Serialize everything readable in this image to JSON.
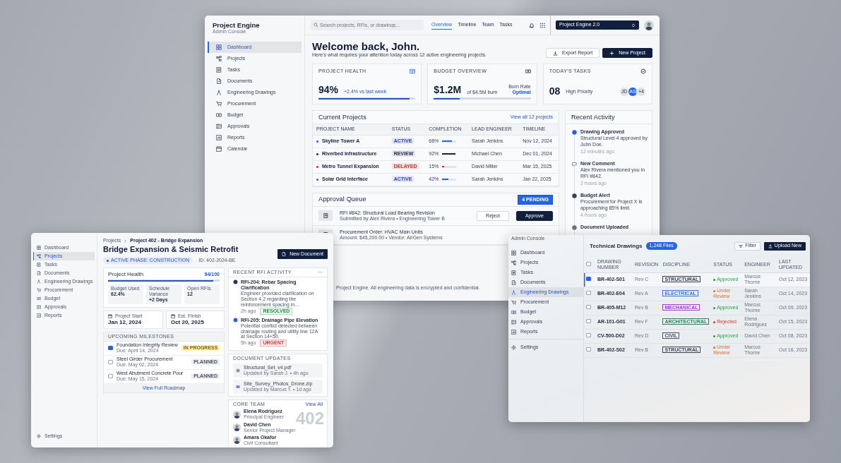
{
  "main_window": {
    "brand": {
      "title": "Project Engine",
      "subtitle": "Admin Console"
    },
    "sidebar": [
      {
        "label": "Dashboard",
        "selected": true
      },
      {
        "label": "Projects",
        "selected": false
      },
      {
        "label": "Tasks",
        "selected": false
      },
      {
        "label": "Documents",
        "selected": false
      },
      {
        "label": "Engineering Drawings",
        "selected": false
      },
      {
        "label": "Procurement",
        "selected": false
      },
      {
        "label": "Budget",
        "selected": false
      },
      {
        "label": "Approvals",
        "selected": false
      },
      {
        "label": "Reports",
        "selected": false
      },
      {
        "label": "Calendar",
        "selected": false
      }
    ],
    "search": {
      "placeholder": "Search projects, RFIs, or drawings..."
    },
    "nav_tabs": [
      {
        "label": "Overview",
        "selected": true
      },
      {
        "label": "Timeline",
        "selected": false
      },
      {
        "label": "Team",
        "selected": false
      },
      {
        "label": "Tasks",
        "selected": false
      }
    ],
    "workspace_button": "Project Engine 2.0",
    "heading": "Welcome back, John.",
    "subheading": "Here's what requires your attention today across 12 active engineering projects.",
    "actions": [
      "Export Report",
      "New Project"
    ],
    "health": {
      "label": "PROJECT HEALTH",
      "value": "94%",
      "delta": "+2.4% vs last week",
      "level": 0.94
    },
    "budget": {
      "label": "BUDGET OVERVIEW",
      "value": "$1.2M",
      "note": "of $4.5M burn",
      "rate_label": "Burn Rate",
      "rate_value": "Optimal",
      "level": 0.27
    },
    "tasks": {
      "label": "TODAY'S TASKS",
      "value": "08",
      "note": "High Priority",
      "chips": [
        {
          "text": "JD",
          "selected": false
        },
        {
          "text": "AS",
          "selected": true
        },
        {
          "text": "+4",
          "selected": false
        }
      ]
    },
    "projects": {
      "title": "Current Projects",
      "link": "View all 12 projects",
      "columns": [
        "PROJECT NAME",
        "STATUS",
        "COMPLETION",
        "LEAD ENGINEER",
        "TIMELINE"
      ],
      "rows": [
        {
          "name": "Skyline Tower A",
          "color": "#2563eb",
          "status": "ACTIVE",
          "kind": "active",
          "completion": "68%",
          "level": 0.68,
          "engineer": "Sarah Jenkins",
          "timeline": "Nov 12, 2024"
        },
        {
          "name": "Riverbed Infrastructure",
          "color": "#1f2937",
          "status": "REVIEW",
          "kind": "review",
          "completion": "92%",
          "level": 0.92,
          "engineer": "Michael Chen",
          "timeline": "Dec 01, 2024"
        },
        {
          "name": "Metro Tunnel Expansion",
          "color": "#dc2626",
          "status": "DELAYED",
          "kind": "delayed",
          "completion": "15%",
          "level": 0.15,
          "engineer": "David Miller",
          "timeline": "Mar 15, 2025"
        },
        {
          "name": "Solar Grid Interface",
          "color": "#2563eb",
          "status": "ACTIVE",
          "kind": "active",
          "completion": "42%",
          "level": 0.42,
          "engineer": "Sarah Jenkins",
          "timeline": "Jan 22, 2025"
        }
      ]
    },
    "approvals": {
      "title": "Approval Queue",
      "badge": "4 PENDING",
      "items": [
        {
          "title": "RFI #842: Structural Load Bearing Revision",
          "meta": "Submitted by Alex Rivera • Engineering Tower B",
          "buttons": [
            "Reject",
            "Approve"
          ]
        },
        {
          "title": "Procurement Order: HVAC Main Units",
          "meta": "Amount: $45,200.00 • Vendor: AirGen Systems"
        }
      ]
    },
    "activity": {
      "title": "Recent Activity",
      "items": [
        {
          "kind": "approved",
          "title": "Drawing Approved",
          "text": "Structural Level 4 approved by John Doe.",
          "time": "12 minutes ago"
        },
        {
          "kind": "comment",
          "title": "New Comment",
          "text": "Alex Rivera mentioned you in RFI #842.",
          "time": "2 hours ago"
        },
        {
          "kind": "alert",
          "title": "Budget Alert",
          "text": "Procurement for Project X is approaching 85% limit.",
          "time": "4 hours ago"
        },
        {
          "kind": "upload",
          "title": "Document Uploaded"
        }
      ]
    },
    "footer": "Project Engine. All engineering data is encrypted and confidential."
  },
  "project_window": {
    "sidebar": [
      {
        "label": "Dashboard",
        "selected": false
      },
      {
        "label": "Projects",
        "selected": true
      },
      {
        "label": "Tasks",
        "selected": false
      },
      {
        "label": "Documents",
        "selected": false
      },
      {
        "label": "Engineering Drawings",
        "selected": false
      },
      {
        "label": "Procurement",
        "selected": false
      },
      {
        "label": "Budget",
        "selected": false
      },
      {
        "label": "Approvals",
        "selected": false
      },
      {
        "label": "Reports",
        "selected": false
      }
    ],
    "settings": "Settings",
    "breadcrumb": [
      "Projects",
      "Project 402 - Bridge Expansion"
    ],
    "title": "Bridge Expansion & Seismic Retrofit",
    "phase": "ACTIVE PHASE: CONSTRUCTION",
    "id": "ID: 402-2024-BE",
    "new_button": "New Document",
    "health": {
      "title": "Project Health",
      "score": "94/100",
      "level": 0.94,
      "metrics": [
        {
          "label": "Budget Used",
          "value": "62.4%"
        },
        {
          "label": "Schedule Variance",
          "value": "+2 Days"
        },
        {
          "label": "Open RFIs",
          "value": "12"
        }
      ]
    },
    "dates": [
      {
        "label": "Project Start",
        "value": "Jan 12, 2024"
      },
      {
        "label": "Est. Finish",
        "value": "Oct 20, 2025"
      }
    ],
    "milestones": {
      "title": "UPCOMING MILESTONES",
      "link": "View Full Roadmap",
      "items": [
        {
          "title": "Foundation Integrity Review",
          "due": "Due: April 14, 2024",
          "status": "IN PROGRESS",
          "kind": "in_progress",
          "checked": true
        },
        {
          "title": "Steel Girder Procurement",
          "due": "Due: May 02, 2024",
          "status": "PLANNED",
          "kind": "planned",
          "checked": false
        },
        {
          "title": "West Abutment Concrete Pour",
          "due": "Due: May 15, 2024",
          "status": "PLANNED",
          "kind": "planned",
          "checked": false
        }
      ]
    },
    "rfi": {
      "title": "RECENT RFI ACTIVITY",
      "menu": "···",
      "items": [
        {
          "title": "RFI-204: Rebar Spacing Clarification",
          "text": "Engineer provided clarification on Section 4.2 regarding the reinforcement spacing in...",
          "time": "2h ago",
          "status": "RESOLVED",
          "kind": "resolved"
        },
        {
          "title": "RFI-205: Drainage Pipe Elevation",
          "text": "Potential conflict detected between drainage routing and utility line 12A at Section 14+50.",
          "time": "5h ago",
          "status": "URGENT",
          "kind": "urgent"
        }
      ]
    },
    "documents": {
      "title": "DOCUMENT UPDATES",
      "items": [
        {
          "kind": "pdf",
          "name": "Structural_Set_v4.pdf",
          "meta": "Updated by Sarah J. • 4h ago"
        },
        {
          "kind": "zip",
          "name": "Site_Survey_Photos_Drone.zip",
          "meta": "Updated by Marcus T. • 1d ago"
        }
      ]
    },
    "team": {
      "title": "CORE TEAM",
      "link": "View All",
      "number": "402",
      "members": [
        {
          "name": "Elena Rodriguez",
          "role": "Principal Engineer"
        },
        {
          "name": "David Chen",
          "role": "Senior Project Manager"
        },
        {
          "name": "Amara Okafor",
          "role": "Civil Consultant"
        }
      ]
    }
  },
  "drawings_window": {
    "header": "Admin Console",
    "sidebar": [
      {
        "label": "Dashboard",
        "selected": false
      },
      {
        "label": "Projects",
        "selected": false
      },
      {
        "label": "Tasks",
        "selected": false
      },
      {
        "label": "Documents",
        "selected": false
      },
      {
        "label": "Engineering Drawings",
        "selected": true
      },
      {
        "label": "Procurement",
        "selected": false
      },
      {
        "label": "Budget",
        "selected": false
      },
      {
        "label": "Approvals",
        "selected": false
      },
      {
        "label": "Reports",
        "selected": false
      }
    ],
    "settings": "Settings",
    "title": "Technical Drawings",
    "count": "1,248 Files",
    "buttons": [
      "Filter",
      "Upload New"
    ],
    "select_all_checked": false,
    "columns": [
      "DRAWING NUMBER",
      "REVISION",
      "DISCIPLINE",
      "STATUS",
      "ENGINEER",
      "LAST UPDATED"
    ],
    "rows": [
      {
        "checked": true,
        "number": "BR-402-S01",
        "revision": "Rev C",
        "discipline": "STRUCTURAL",
        "color": "#374151",
        "status": "Approved",
        "kind": "approved",
        "engineer": "Marcus Thorne",
        "updated": "Oct 12, 2023"
      },
      {
        "checked": false,
        "number": "BR-402-E04",
        "revision": "Rev A",
        "discipline": "ELECTRICAL",
        "color": "#3b6fd6",
        "status": "Under Review",
        "kind": "review",
        "engineer": "Sarah Jenkins",
        "updated": "Oct 14, 2023"
      },
      {
        "checked": false,
        "number": "BR-405-M12",
        "revision": "Rev B",
        "discipline": "MECHANICAL",
        "color": "#9b3fd0",
        "status": "Approved",
        "kind": "approved",
        "engineer": "Marcus Thorne",
        "updated": "Oct 09, 2023"
      },
      {
        "checked": false,
        "number": "AR-101-G01",
        "revision": "Rev F",
        "discipline": "ARCHITECTURAL",
        "color": "#2e7d5b",
        "status": "Rejected",
        "kind": "rejected",
        "engineer": "Elena Rodriguez",
        "updated": "Oct 15, 2023"
      },
      {
        "checked": false,
        "number": "CV-500-D02",
        "revision": "Rev D",
        "discipline": "CIVIL",
        "color": "#4b5563",
        "status": "Approved",
        "kind": "approved",
        "engineer": "David Chen",
        "updated": "Oct 08, 2023"
      },
      {
        "checked": false,
        "number": "BR-402-S02",
        "revision": "Rev B",
        "discipline": "STRUCTURAL",
        "color": "#374151",
        "status": "Under Review",
        "kind": "review",
        "engineer": "Marcus Thorne",
        "updated": "Oct 16, 2023"
      }
    ]
  }
}
